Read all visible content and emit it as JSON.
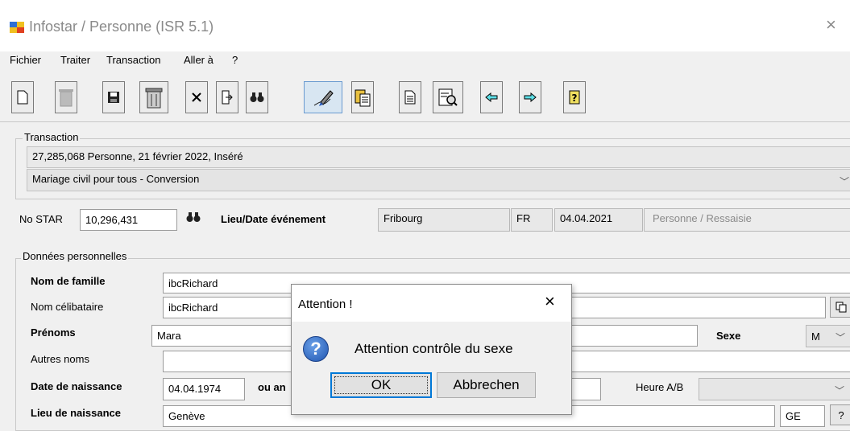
{
  "window": {
    "title": "Infostar / Personne (ISR 5.1)",
    "close_glyph": "×"
  },
  "menu": [
    "Fichier",
    "Traiter",
    "Transaction",
    "Aller à",
    "?"
  ],
  "toolbar": {
    "buttons": [
      {
        "name": "new-document-icon",
        "glyph": "🗋"
      },
      {
        "name": "delete-disabled-icon",
        "glyph": "🗑"
      },
      {
        "name": "save-icon",
        "glyph": "💾"
      },
      {
        "name": "trash-icon",
        "glyph": "🗑"
      },
      {
        "name": "cancel-icon",
        "glyph": "✕"
      },
      {
        "name": "import-icon",
        "glyph": "⇲"
      },
      {
        "name": "binoculars-icon",
        "glyph": "👁"
      },
      {
        "name": "edit-pen-icon",
        "glyph": "✍"
      },
      {
        "name": "paste-icon",
        "glyph": "📋"
      },
      {
        "name": "document-icon",
        "glyph": "🗎"
      },
      {
        "name": "preview-icon",
        "glyph": "🔍"
      },
      {
        "name": "arrow-left-icon",
        "glyph": "⇦"
      },
      {
        "name": "arrow-right-icon",
        "glyph": "⇨"
      },
      {
        "name": "help-icon",
        "glyph": "?"
      }
    ]
  },
  "transaction": {
    "group_label": "Transaction",
    "line1": "27,285,068  Personne, 21 février 2022, Inséré",
    "type_value": "Mariage civil pour tous - Conversion"
  },
  "star": {
    "no_star_label": "No STAR",
    "no_star_value": "10,296,431",
    "lieu_date_label": "Lieu/Date événement",
    "place": "Fribourg",
    "canton": "FR",
    "date": "04.04.2021",
    "status": "Personne / Ressaisie"
  },
  "personal": {
    "group_label": "Données personnelles",
    "family_name_label": "Nom de famille",
    "family_name_value": "ibcRichard",
    "maiden_name_label": "Nom célibataire",
    "maiden_name_value": "ibcRichard",
    "first_names_label": "Prénoms",
    "first_names_value": "Mara",
    "sex_label": "Sexe",
    "sex_value": "M",
    "other_names_label": "Autres noms",
    "other_names_value": "",
    "birth_date_label": "Date de naissance",
    "birth_date_value": "04.04.1974",
    "or_year_label": "ou an",
    "time_label": "Heure A/B",
    "birth_place_label": "Lieu de naissance",
    "birth_place_value": "Genève",
    "birth_place_canton": "GE",
    "birth_place_help": "?"
  },
  "dialog": {
    "title": "Attention !",
    "message": "Attention contrôle du sexe",
    "ok_label": "OK",
    "cancel_label": "Abbrechen",
    "close_glyph": "×"
  }
}
